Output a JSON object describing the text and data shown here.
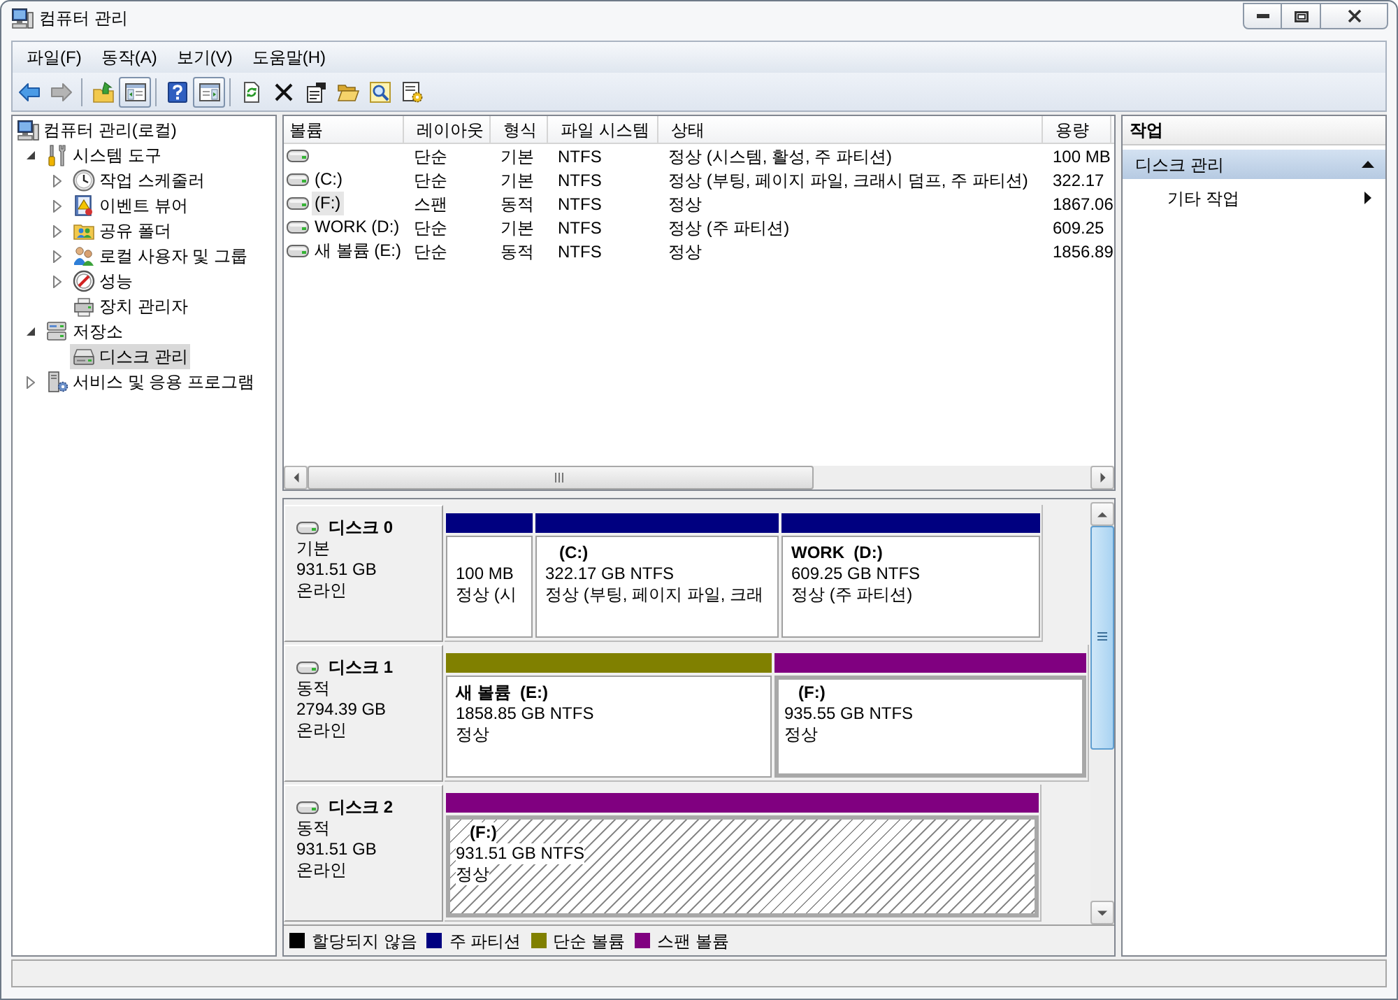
{
  "window": {
    "title": "컴퓨터 관리"
  },
  "menu": [
    "파일(F)",
    "동작(A)",
    "보기(V)",
    "도움말(H)"
  ],
  "toolbar": {
    "groups": [
      [
        {
          "kind": "back",
          "pressed": false,
          "disabled": false
        },
        {
          "kind": "forward",
          "pressed": false,
          "disabled": true
        }
      ],
      [
        {
          "kind": "up",
          "pressed": false,
          "disabled": false
        },
        {
          "kind": "console-tree",
          "pressed": true,
          "disabled": false
        }
      ],
      [
        {
          "kind": "help",
          "pressed": false,
          "disabled": false
        },
        {
          "kind": "action-pane",
          "pressed": true,
          "disabled": false
        }
      ],
      [
        {
          "kind": "refresh",
          "pressed": false,
          "disabled": false
        },
        {
          "kind": "delete",
          "pressed": false,
          "disabled": false
        },
        {
          "kind": "properties",
          "pressed": false,
          "disabled": false
        },
        {
          "kind": "open",
          "pressed": false,
          "disabled": false
        },
        {
          "kind": "search",
          "pressed": false,
          "disabled": false
        },
        {
          "kind": "settings",
          "pressed": false,
          "disabled": false
        }
      ]
    ]
  },
  "tree": {
    "label": "컴퓨터 관리(로컬)",
    "kind": "computer",
    "selected": false,
    "children": [
      {
        "label": "시스템 도구",
        "kind": "tools",
        "selected": false,
        "expanded": true,
        "children": [
          {
            "label": "작업 스케줄러",
            "kind": "clock",
            "selected": false,
            "expanded": false
          },
          {
            "label": "이벤트 뷰어",
            "kind": "event-log",
            "selected": false,
            "expanded": false
          },
          {
            "label": "공유 폴더",
            "kind": "shared-folder",
            "selected": false,
            "expanded": false
          },
          {
            "label": "로컬 사용자 및 그룹",
            "kind": "users",
            "selected": false,
            "expanded": false
          },
          {
            "label": "성능",
            "kind": "performance",
            "selected": false,
            "expanded": false
          },
          {
            "label": "장치 관리자",
            "kind": "device",
            "selected": false
          }
        ]
      },
      {
        "label": "저장소",
        "kind": "storage",
        "selected": false,
        "expanded": true,
        "children": [
          {
            "label": "디스크 관리",
            "kind": "disk",
            "selected": true
          }
        ]
      },
      {
        "label": "서비스 및 응용 프로그램",
        "kind": "services",
        "selected": false,
        "expanded": false
      }
    ]
  },
  "volume_list": {
    "columns": [
      "볼륨",
      "레이아웃",
      "형식",
      "파일 시스템",
      "상태",
      "용량"
    ],
    "rows": [
      {
        "layout": "단순",
        "type": "기본",
        "file_system": "NTFS",
        "status": "정상 (시스템, 활성, 주 파티션)",
        "capacity": "100 MB",
        "selected": false
      },
      {
        "volume": "(C:)",
        "layout": "단순",
        "type": "기본",
        "file_system": "NTFS",
        "status": "정상 (부팅, 페이지 파일, 크래시 덤프, 주 파티션)",
        "capacity": "322.17",
        "selected": false
      },
      {
        "volume": "(F:)",
        "layout": "스팬",
        "type": "동적",
        "file_system": "NTFS",
        "status": "정상",
        "capacity": "1867.06",
        "selected": true
      },
      {
        "volume": "WORK (D:)",
        "layout": "단순",
        "type": "기본",
        "file_system": "NTFS",
        "status": "정상 (주 파티션)",
        "capacity": "609.25",
        "selected": false
      },
      {
        "volume": "새 볼륨 (E:)",
        "layout": "단순",
        "type": "동적",
        "file_system": "NTFS",
        "status": "정상",
        "capacity": "1856.89",
        "selected": false
      }
    ]
  },
  "disks": [
    {
      "name": "디스크 0",
      "type": "기본",
      "size": "931.51 GB",
      "status": "온라인",
      "partitions": [
        {
          "kind": "primary",
          "size": "100 MB",
          "status": "정상 (시",
          "selected": false,
          "focused": false
        },
        {
          "kind": "primary",
          "drive": "(C:)",
          "size": "322.17 GB NTFS",
          "status": "정상 (부팅, 페이지 파일, 크래",
          "selected": false,
          "focused": false
        },
        {
          "kind": "primary",
          "label": "WORK",
          "drive": "(D:)",
          "size": "609.25 GB NTFS",
          "status": "정상 (주 파티션)",
          "selected": false,
          "focused": false
        }
      ]
    },
    {
      "name": "디스크 1",
      "type": "동적",
      "size": "2794.39 GB",
      "status": "온라인",
      "partitions": [
        {
          "kind": "simple",
          "label": "새 볼륨",
          "drive": "(E:)",
          "size": "1858.85 GB NTFS",
          "status": "정상",
          "selected": false,
          "focused": false
        },
        {
          "kind": "spanned",
          "drive": "(F:)",
          "size": "935.55 GB NTFS",
          "status": "정상",
          "selected": true,
          "focused": false
        }
      ]
    },
    {
      "name": "디스크 2",
      "type": "동적",
      "size": "931.51 GB",
      "status": "온라인",
      "partitions": [
        {
          "kind": "spanned",
          "drive": "(F:)",
          "size": "931.51 GB NTFS",
          "status": "정상",
          "selected": true,
          "focused": true
        }
      ]
    }
  ],
  "legend": [
    {
      "label": "할당되지 않음",
      "color": "#000000"
    },
    {
      "label": "주 파티션",
      "color": "#000080"
    },
    {
      "label": "단순 볼륨",
      "color": "#808000"
    },
    {
      "label": "스팬 볼륨",
      "color": "#800080"
    }
  ],
  "actions": {
    "title": "작업",
    "sections": [
      {
        "label": "디스크 관리",
        "expanded": true,
        "items": [
          {
            "label": "기타 작업",
            "submenu": true
          }
        ]
      }
    ]
  }
}
